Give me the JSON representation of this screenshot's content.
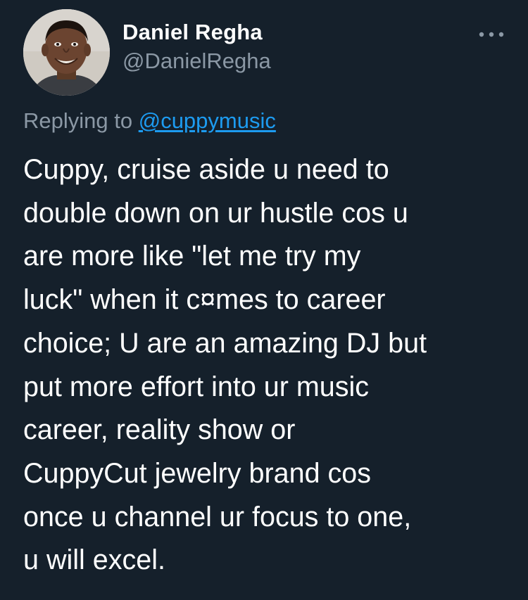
{
  "author": {
    "display_name": "Daniel Regha",
    "handle": "@DanielRegha"
  },
  "more_icon": "more-horizontal-icon",
  "reply": {
    "prefix": "Replying to ",
    "mention": "@cuppymusic"
  },
  "tweet": {
    "text": "Cuppy, cruise aside u need to\ndouble down on ur hustle cos u\nare more like \"let me try my\nluck\" when it c¤mes to career\nchoice; U are an amazing DJ but\nput more effort into ur music\ncareer, reality show or\nCuppyCut jewelry brand cos\nonce u channel ur focus to one,\nu will excel."
  },
  "colors": {
    "background": "#15202b",
    "primary_text": "#ffffff",
    "secondary_text": "#8b98a5",
    "link": "#1d9bf0"
  }
}
